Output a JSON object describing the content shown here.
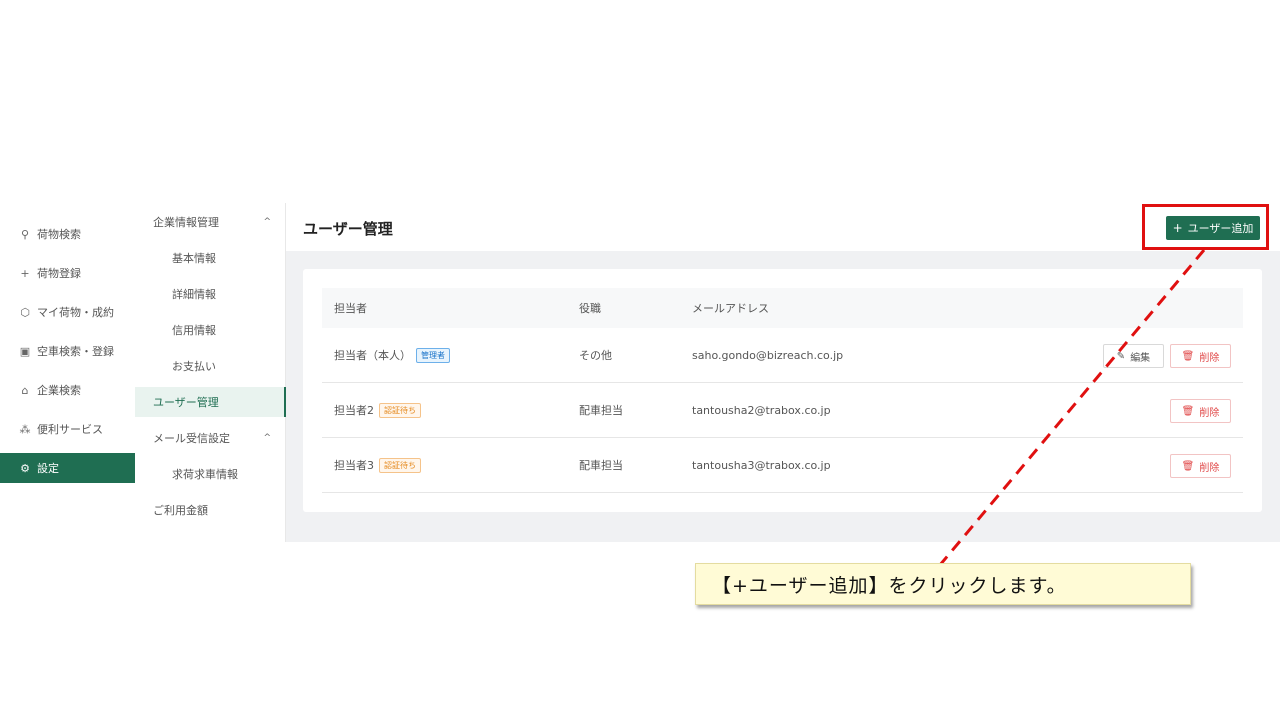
{
  "left_nav": {
    "items": [
      {
        "icon": "search-icon",
        "glyph": "⚲",
        "label": "荷物検索"
      },
      {
        "icon": "plus-icon",
        "glyph": "+",
        "label": "荷物登録"
      },
      {
        "icon": "cube-icon",
        "glyph": "⬡",
        "label": "マイ荷物・成約"
      },
      {
        "icon": "truck-icon",
        "glyph": "▣",
        "label": "空車検索・登録"
      },
      {
        "icon": "home-icon",
        "glyph": "⌂",
        "label": "企業検索"
      },
      {
        "icon": "people-icon",
        "glyph": "⁂",
        "label": "便利サービス"
      },
      {
        "icon": "gear-icon",
        "glyph": "⚙",
        "label": "設定"
      }
    ]
  },
  "sub_nav": {
    "items": [
      {
        "label": "企業情報管理",
        "type": "group"
      },
      {
        "label": "基本情報",
        "type": "child"
      },
      {
        "label": "詳細情報",
        "type": "child"
      },
      {
        "label": "信用情報",
        "type": "child"
      },
      {
        "label": "お支払い",
        "type": "child"
      },
      {
        "label": "ユーザー管理",
        "type": "group"
      },
      {
        "label": "メール受信設定",
        "type": "group"
      },
      {
        "label": "求荷求車情報",
        "type": "child"
      },
      {
        "label": "ご利用金額",
        "type": "group"
      }
    ],
    "caret": "^"
  },
  "main": {
    "title": "ユーザー管理",
    "add_button": {
      "plus": "+",
      "label": "ユーザー追加"
    },
    "table": {
      "headers": [
        "担当者",
        "役職",
        "メールアドレス"
      ],
      "rows": [
        {
          "name": "担当者（本人）",
          "badge": "管理者",
          "role": "その他",
          "email": "saho.gondo@bizreach.co.jp"
        },
        {
          "name": "担当者2",
          "badge": "認証待ち",
          "role": "配車担当",
          "email": "tantousha2@trabox.co.jp"
        },
        {
          "name": "担当者3",
          "badge": "認証待ち",
          "role": "配車担当",
          "email": "tantousha3@trabox.co.jp"
        }
      ],
      "edit_label": "編集",
      "delete_label": "削除"
    }
  },
  "annotation": {
    "callout_text": "【+ユーザー追加】をクリックします。",
    "highlight_color": "#e01010"
  },
  "colors": {
    "brand_green": "#1f6e52",
    "delete_red": "#e04848"
  }
}
